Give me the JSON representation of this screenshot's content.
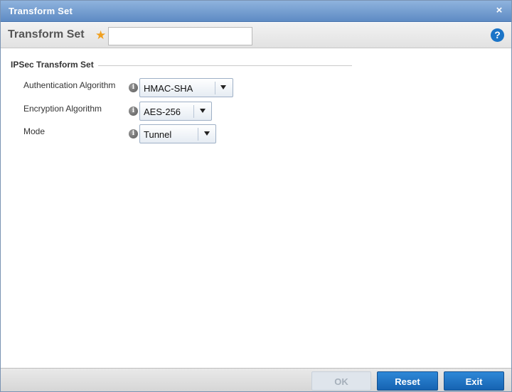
{
  "titlebar": {
    "title": "Transform Set",
    "close_glyph": "×"
  },
  "namebar": {
    "label": "Transform Set",
    "required_glyph": "★",
    "value": "",
    "placeholder": "",
    "help_glyph": "?"
  },
  "section": {
    "title": "IPSec Transform Set"
  },
  "fields": [
    {
      "label": "Authentication Algorithm",
      "info_glyph": "i",
      "value": "HMAC-SHA"
    },
    {
      "label": "Encryption Algorithm",
      "info_glyph": "i",
      "value": "AES-256"
    },
    {
      "label": "Mode",
      "info_glyph": "i",
      "value": "Tunnel"
    }
  ],
  "footer": {
    "ok_label": "OK",
    "reset_label": "Reset",
    "exit_label": "Exit"
  },
  "colors": {
    "titlebar": "#6f9bd0",
    "accent_button": "#1e70c2",
    "required_star": "#f0a020",
    "help_icon": "#1b74c7",
    "disabled_button": "#dfe5ec"
  },
  "icons": {
    "close": "close-icon",
    "required": "required-star-icon",
    "help": "help-icon",
    "info": "info-icon",
    "dropdown": "chevron-down-icon"
  }
}
